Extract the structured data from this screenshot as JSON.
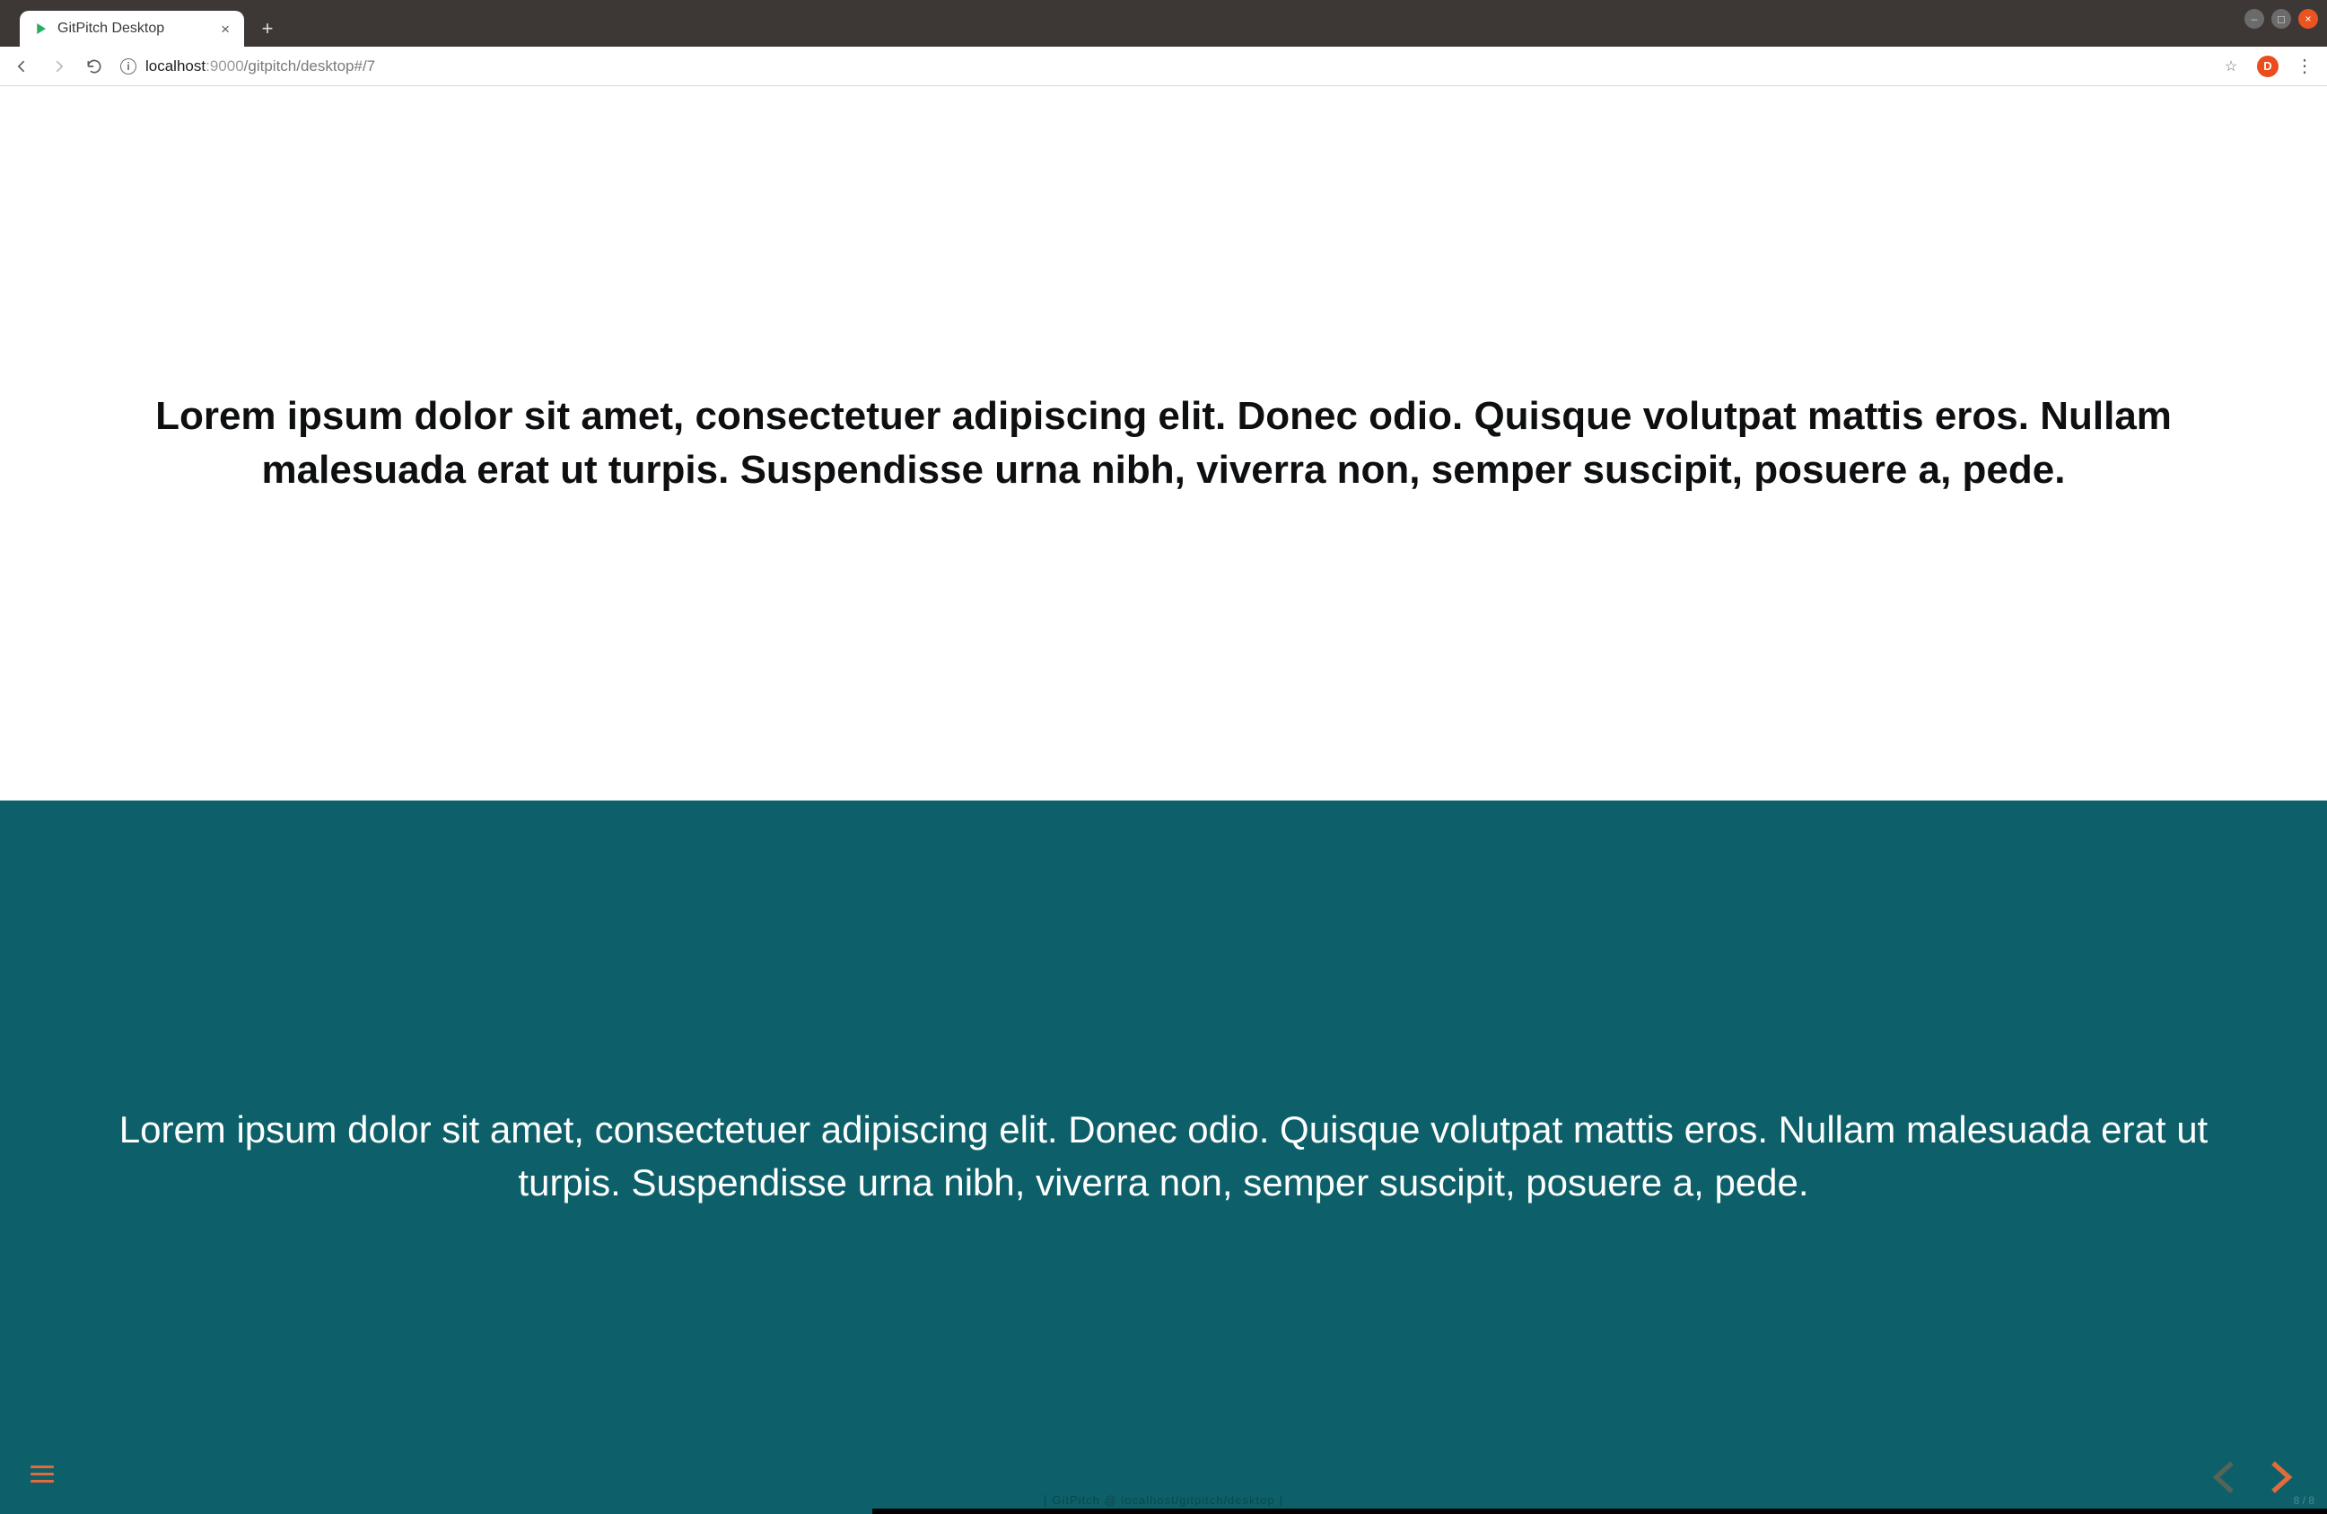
{
  "window": {
    "tab_title": "GitPitch Desktop",
    "favicon_color": "#27ae60",
    "win_min": "—",
    "win_max": "◻",
    "win_close": "✕",
    "newtab": "+"
  },
  "toolbar": {
    "url_host": "localhost",
    "url_port": ":9000",
    "url_path": "/gitpitch/desktop#/7",
    "info_glyph": "i",
    "avatar_letter": "D",
    "menu_glyph": "⋮",
    "star_glyph": "☆"
  },
  "slide": {
    "top_text": "Lorem ipsum dolor sit amet, consectetuer adipiscing elit. Donec odio. Quisque volutpat mattis eros. Nullam malesuada erat ut turpis. Suspendisse urna nibh, viverra non, semper suscipit, posuere a, pede.",
    "bottom_text": "Lorem ipsum dolor sit amet, consectetuer adipiscing elit. Donec odio. Quisque volutpat mattis eros. Nullam malesuada erat ut turpis. Suspendisse urna nibh, viverra non, semper suscipit, posuere a, pede.",
    "bottom_bg": "#0d6069",
    "accent_color": "#e06b3b"
  },
  "footer": {
    "text": "[ GitPitch @ localhost/gitpitch/desktop ]",
    "slide_counter": "8 / 8"
  }
}
